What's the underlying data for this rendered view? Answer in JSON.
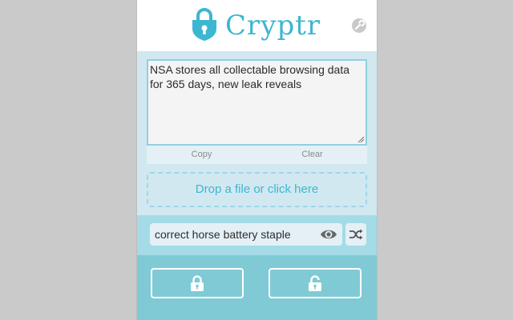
{
  "app": {
    "title": "Cryptr"
  },
  "icons": {
    "logo": "lock-icon",
    "settings": "wrench-icon",
    "visibility": "eye-icon",
    "generate": "shuffle-icon",
    "encrypt": "lock-icon",
    "decrypt": "unlock-icon"
  },
  "colors": {
    "accent": "#3cb7d1",
    "background": "#cacaca",
    "section_light": "#d1e8f1",
    "section_mid": "#a4dbe6",
    "section_dark": "#7fcad5"
  },
  "message": {
    "value": "NSA stores all collectable browsing data for 365 days, new leak reveals"
  },
  "actions": {
    "copy_label": "Copy",
    "clear_label": "Clear"
  },
  "dropzone": {
    "label": "Drop a file or click here"
  },
  "password": {
    "value": "correct horse battery staple"
  }
}
